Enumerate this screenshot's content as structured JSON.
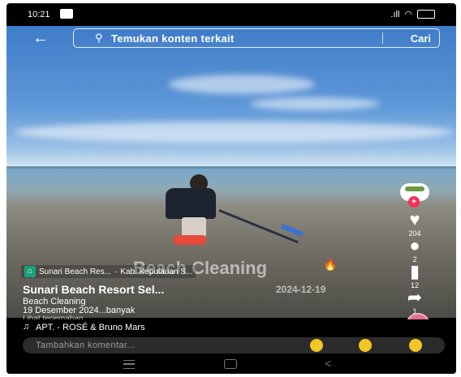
{
  "status_bar": {
    "time": "10:21"
  },
  "search": {
    "back_icon": "arrow-left-icon",
    "placeholder": "Temukan konten terkait",
    "button": "Cari"
  },
  "video": {
    "overlay_title": "Beach Cleaning",
    "location": {
      "name": "Sunari Beach Res...",
      "region": "Kab. Kepulauan S..."
    },
    "author": "Sunari Beach Resort Sel...",
    "date": "2024-12-19",
    "caption_line1": "Beach Cleaning",
    "caption_line2": "19 Desember 2024...banyak",
    "translate_link": "Lihat terjemahan"
  },
  "actions": {
    "likes": "204",
    "comments": "2",
    "saves": "12",
    "shares": "1"
  },
  "music": {
    "title": "APT. - ROSÉ & Bruno Mars"
  },
  "comment": {
    "placeholder": "Tambahkan komentar..."
  },
  "colors": {
    "follow": "#ff2b55",
    "emoji": "#f3c623",
    "rake": "#3d6fd1"
  }
}
